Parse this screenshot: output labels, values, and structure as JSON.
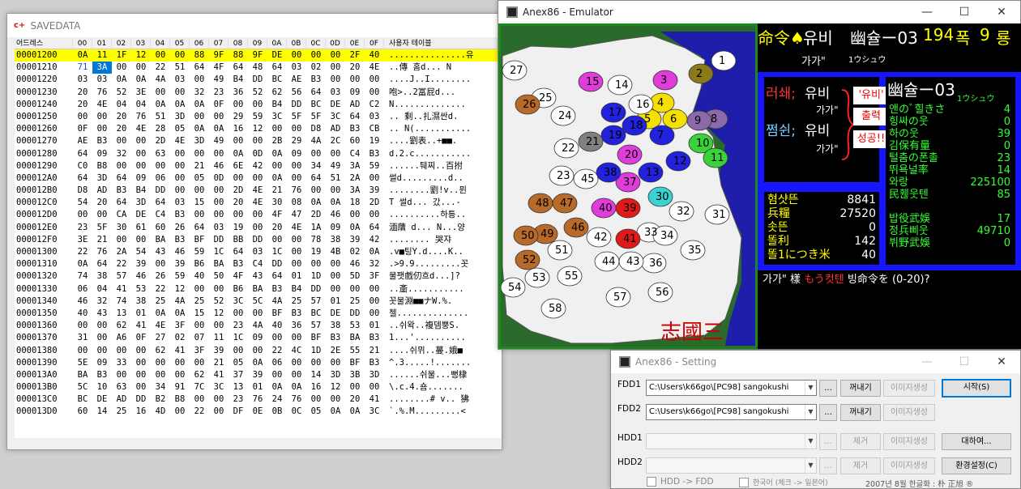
{
  "savedata": {
    "title": "SAVEDATA",
    "icon_text": "c+",
    "header": {
      "addr": "어드레스",
      "cols": [
        "00",
        "01",
        "02",
        "03",
        "04",
        "05",
        "06",
        "07",
        "08",
        "09",
        "0A",
        "0B",
        "0C",
        "0D",
        "0E",
        "0F"
      ],
      "text": "사용자 테이블"
    },
    "rows": [
      {
        "addr": "00001200",
        "bytes": [
          "0A",
          "11",
          "1F",
          "12",
          "00",
          "00",
          "88",
          "9F",
          "88",
          "9F",
          "DE",
          "00",
          "00",
          "00",
          "2F",
          "40"
        ],
        "text": "...............유"
      },
      {
        "addr": "00001210",
        "bytes": [
          "71",
          "3A",
          "00",
          "00",
          "22",
          "51",
          "64",
          "4F",
          "64",
          "48",
          "64",
          "03",
          "02",
          "00",
          "20",
          "4E"
        ],
        "text": "..傳 홈d... N"
      },
      {
        "addr": "00001220",
        "bytes": [
          "03",
          "03",
          "0A",
          "0A",
          "4A",
          "03",
          "00",
          "49",
          "B4",
          "DD",
          "BC",
          "AE",
          "B3",
          "00",
          "00",
          "00"
        ],
        "text": "....J..I........"
      },
      {
        "addr": "00001230",
        "bytes": [
          "20",
          "76",
          "52",
          "3E",
          "00",
          "00",
          "32",
          "23",
          "36",
          "52",
          "62",
          "56",
          "64",
          "03",
          "09",
          "00"
        ],
        "text": " 咆>..2冨屁d..."
      },
      {
        "addr": "00001240",
        "bytes": [
          "20",
          "4E",
          "04",
          "04",
          "0A",
          "0A",
          "0A",
          "0F",
          "00",
          "00",
          "B4",
          "DD",
          "BC",
          "DE",
          "AD",
          "C2"
        ],
        "text": " N.............."
      },
      {
        "addr": "00001250",
        "bytes": [
          "00",
          "00",
          "20",
          "76",
          "51",
          "3D",
          "00",
          "00",
          "29",
          "59",
          "3C",
          "5F",
          "5F",
          "3C",
          "64",
          "03"
        ],
        "text": ".. 剩..扎濕싼d."
      },
      {
        "addr": "00001260",
        "bytes": [
          "0F",
          "00",
          "20",
          "4E",
          "28",
          "05",
          "0A",
          "0A",
          "16",
          "12",
          "00",
          "00",
          "D8",
          "AD",
          "B3",
          "CB"
        ],
        "text": ".. N(..........."
      },
      {
        "addr": "00001270",
        "bytes": [
          "AE",
          "B3",
          "00",
          "00",
          "2D",
          "4E",
          "3D",
          "49",
          "00",
          "00",
          "2B",
          "29",
          "4A",
          "2C",
          "60",
          "19"
        ],
        "text": "....劉表..+■■."
      },
      {
        "addr": "00001280",
        "bytes": [
          "64",
          "09",
          "32",
          "00",
          "63",
          "00",
          "00",
          "00",
          "0A",
          "0D",
          "0A",
          "09",
          "00",
          "00",
          "C4",
          "B3"
        ],
        "text": "d.2.c..........."
      },
      {
        "addr": "00001290",
        "bytes": [
          "C0",
          "B8",
          "00",
          "00",
          "00",
          "00",
          "21",
          "46",
          "6E",
          "42",
          "00",
          "00",
          "34",
          "49",
          "3A",
          "59"
        ],
        "text": "......퉤찌..百拊"
      },
      {
        "addr": "000012A0",
        "bytes": [
          "64",
          "3D",
          "64",
          "09",
          "06",
          "00",
          "05",
          "0D",
          "00",
          "00",
          "0A",
          "00",
          "64",
          "51",
          "2A",
          "00"
        ],
        "text": "썰d.........d.."
      },
      {
        "addr": "000012B0",
        "bytes": [
          "D8",
          "AD",
          "B3",
          "B4",
          "DD",
          "00",
          "00",
          "00",
          "2D",
          "4E",
          "21",
          "76",
          "00",
          "00",
          "3A",
          "39"
        ],
        "text": "........劉!v..뮌"
      },
      {
        "addr": "000012C0",
        "bytes": [
          "54",
          "20",
          "64",
          "3D",
          "64",
          "03",
          "15",
          "00",
          "20",
          "4E",
          "30",
          "08",
          "0A",
          "0A",
          "18",
          "2D"
        ],
        "text": "T 썰d... 갔...-"
      },
      {
        "addr": "000012D0",
        "bytes": [
          "00",
          "00",
          "CA",
          "DE",
          "C4",
          "B3",
          "00",
          "00",
          "00",
          "00",
          "4F",
          "47",
          "2D",
          "46",
          "00",
          "00"
        ],
        "text": "..........하틍.."
      },
      {
        "addr": "000012E0",
        "bytes": [
          "23",
          "5F",
          "30",
          "61",
          "60",
          "26",
          "64",
          "03",
          "19",
          "00",
          "20",
          "4E",
          "1A",
          "09",
          "0A",
          "64"
        ],
        "text": "湎藬  d... N...양"
      },
      {
        "addr": "000012F0",
        "bytes": [
          "3E",
          "21",
          "00",
          "00",
          "BA",
          "B3",
          "BF",
          "DD",
          "BB",
          "DD",
          "00",
          "00",
          "78",
          "38",
          "39",
          "42"
        ],
        "text": "........ 哭쟈"
      },
      {
        "addr": "00001300",
        "bytes": [
          "22",
          "76",
          "2A",
          "54",
          "43",
          "46",
          "59",
          "1C",
          "64",
          "03",
          "1C",
          "00",
          "19",
          "4B",
          "02",
          "0A"
        ],
        "text": ".v■팅Y.d....K.."
      },
      {
        "addr": "00001310",
        "bytes": [
          "0A",
          "64",
          "22",
          "39",
          "00",
          "39",
          "B6",
          "BA",
          "B3",
          "C4",
          "DD",
          "00",
          "00",
          "00",
          "46",
          "32"
        ],
        "text": ".>9.9.........꼿"
      },
      {
        "addr": "00001320",
        "bytes": [
          "74",
          "38",
          "57",
          "46",
          "26",
          "59",
          "40",
          "50",
          "4F",
          "43",
          "64",
          "01",
          "1D",
          "00",
          "5D",
          "3F"
        ],
        "text": "물팻戲仞흐d...]?"
      },
      {
        "addr": "00001330",
        "bytes": [
          "06",
          "04",
          "41",
          "53",
          "22",
          "12",
          "00",
          "00",
          "B6",
          "BA",
          "B3",
          "B4",
          "DD",
          "00",
          "00",
          "00"
        ],
        "text": "..齑..........."
      },
      {
        "addr": "00001340",
        "bytes": [
          "46",
          "32",
          "74",
          "38",
          "25",
          "4A",
          "25",
          "52",
          "3C",
          "5C",
          "4A",
          "25",
          "57",
          "01",
          "25",
          "00"
        ],
        "text": "꼿물淵■■ナW.%."
      },
      {
        "addr": "00001350",
        "bytes": [
          "40",
          "43",
          "13",
          "01",
          "0A",
          "0A",
          "15",
          "12",
          "00",
          "00",
          "BF",
          "B3",
          "BC",
          "DE",
          "DD",
          "00"
        ],
        "text": "첼.............."
      },
      {
        "addr": "00001360",
        "bytes": [
          "00",
          "00",
          "62",
          "41",
          "4E",
          "3F",
          "00",
          "00",
          "23",
          "4A",
          "40",
          "36",
          "57",
          "38",
          "53",
          "01"
        ],
        "text": "..쉬왁..複뎀뿡S."
      },
      {
        "addr": "00001370",
        "bytes": [
          "31",
          "00",
          "A6",
          "0F",
          "27",
          "02",
          "07",
          "11",
          "1C",
          "09",
          "00",
          "00",
          "BF",
          "B3",
          "BA",
          "B3"
        ],
        "text": "1...'.........."
      },
      {
        "addr": "00001380",
        "bge": "",
        "bytes": [
          "00",
          "00",
          "00",
          "00",
          "62",
          "41",
          "3F",
          "39",
          "00",
          "00",
          "22",
          "4C",
          "1D",
          "2E",
          "55",
          "21"
        ],
        "text": "....쉬뮈..蔓.娥■"
      },
      {
        "addr": "00001390",
        "bytes": [
          "5E",
          "09",
          "33",
          "00",
          "00",
          "00",
          "00",
          "21",
          "05",
          "0A",
          "06",
          "00",
          "00",
          "00",
          "BF",
          "B3"
        ],
        "text": "^.3.....!......."
      },
      {
        "addr": "000013A0",
        "bytes": [
          "BA",
          "B3",
          "00",
          "00",
          "00",
          "00",
          "62",
          "41",
          "37",
          "39",
          "00",
          "00",
          "14",
          "3D",
          "3B",
          "3D"
        ],
        "text": "......쉬물...뻥棣"
      },
      {
        "addr": "000013B0",
        "bytes": [
          "5C",
          "10",
          "63",
          "00",
          "34",
          "91",
          "7C",
          "3C",
          "13",
          "01",
          "0A",
          "0A",
          "16",
          "12",
          "00",
          "00"
        ],
        "text": "\\.c.4.숌......."
      },
      {
        "addr": "000013C0",
        "bytes": [
          "BC",
          "DE",
          "AD",
          "DD",
          "B2",
          "B8",
          "00",
          "00",
          "23",
          "76",
          "24",
          "76",
          "00",
          "00",
          "20",
          "41"
        ],
        "text": "........# v.. 狒"
      },
      {
        "addr": "000013D0",
        "bytes": [
          "60",
          "14",
          "25",
          "16",
          "4D",
          "00",
          "22",
          "00",
          "DF",
          "0E",
          "0B",
          "0C",
          "05",
          "0A",
          "0A",
          "3C"
        ],
        "text": "`.%.M.........<"
      }
    ]
  },
  "emulator": {
    "title": "Anex86 - Emulator",
    "top": {
      "cmd": "命令♠",
      "name": "유비",
      "era": "幽슐ー03",
      "year": "194",
      "year_unit": "폭",
      "month": "9",
      "month_unit": "룡",
      "name2": "가가\"",
      "kana": "1ウシュウ"
    },
    "ruler": {
      "l1_label": "러쇄;",
      "l1_name": "유비",
      "l1_suffix": "가가\"",
      "l2_label": "쩜쉰;",
      "l2_name": "유비",
      "l2_suffix": "가가\""
    },
    "popup": {
      "quote": "'유비'",
      "out": "출력",
      "ok": "성공!!"
    },
    "province": {
      "title": "幽슐ー03",
      "kana": "1ウシュウ",
      "stats": [
        {
          "k": "앤のﾞ힐きさ",
          "v": "4"
        },
        {
          "k": "힝싸の웃",
          "v": "0"
        },
        {
          "k": "하の웃",
          "v": "39"
        },
        {
          "k": "김保有量",
          "v": "0"
        },
        {
          "k": "털춤の폰촐",
          "v": "23"
        },
        {
          "k": "뛰욕널率",
          "v": "14"
        },
        {
          "k": "와랑",
          "v": "225100"
        },
        {
          "k": "民휂웃텐",
          "v": "85"
        },
        {
          "k": "",
          "v": ""
        },
        {
          "k": "밥役武娛",
          "v": "17"
        },
        {
          "k": "정兵삐웃",
          "v": "49710"
        },
        {
          "k": "뷔野武娛",
          "v": "0"
        }
      ]
    },
    "resources": [
      {
        "k": "혐샷뜬",
        "v": "8841"
      },
      {
        "k": "兵糧",
        "v": "27520"
      },
      {
        "k": "솟뜬",
        "v": "0"
      },
      {
        "k": "똘利",
        "v": "142"
      },
      {
        "k": "똘1につき米",
        "v": "40"
      }
    ],
    "prompt": {
      "a": "가가\" 樣",
      "b": "もう컷텐",
      "c": "빙命令を (0-20)?"
    },
    "map_title": "志國三",
    "provinces": [
      "1",
      "2",
      "3",
      "4",
      "5",
      "6",
      "7",
      "8",
      "9",
      "10",
      "11",
      "12",
      "13",
      "14",
      "15",
      "16",
      "17",
      "18",
      "19",
      "20",
      "21",
      "22",
      "23",
      "24",
      "25",
      "26",
      "27",
      "30",
      "31",
      "32",
      "33",
      "34",
      "35",
      "36",
      "37",
      "38",
      "39",
      "40",
      "41",
      "42",
      "43",
      "44",
      "45",
      "46",
      "47",
      "48",
      "49",
      "50",
      "51",
      "52",
      "53",
      "54",
      "55",
      "56",
      "57",
      "58"
    ]
  },
  "setting": {
    "title": "Anex86 - Setting",
    "fdd1": {
      "label": "FDD1",
      "value": "C:\\Users\\k66go\\[PC98] sangokushi"
    },
    "fdd2": {
      "label": "FDD2",
      "value": "C:\\Users\\k66go\\[PC98] sangokushi"
    },
    "hdd1": {
      "label": "HDD1",
      "value": ""
    },
    "hdd2": {
      "label": "HDD2",
      "value": ""
    },
    "btn_browse": "...",
    "btn_eject": "꺼내기",
    "btn_image": "이미지생성",
    "btn_remove": "제거",
    "btn_start": "시작(S)",
    "btn_more": "대하여...",
    "btn_env": "환경설정(C)",
    "chk1": "HDD -> FDD",
    "chk2": "한국어 (체크 -> 일본어)",
    "footer": "2007년 8월 한글화 : 朴 正旭 ®"
  }
}
